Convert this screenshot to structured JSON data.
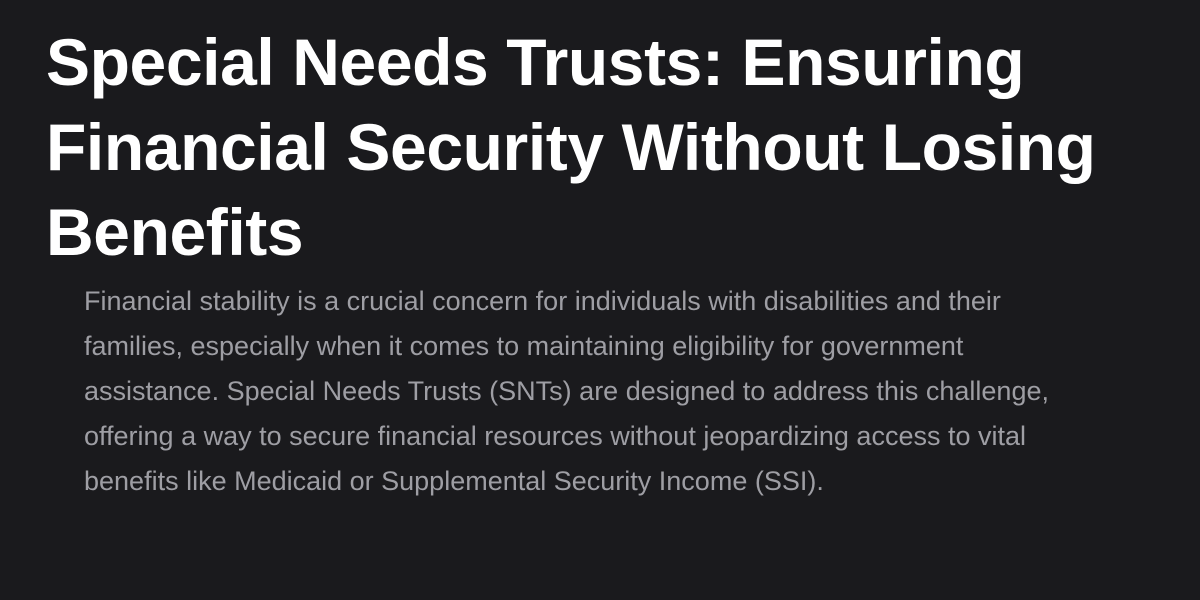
{
  "article": {
    "title": "Special Needs Trusts: Ensuring Financial Security Without Losing Benefits",
    "intro": "Financial stability is a crucial concern for individuals with disabilities and their families, especially when it comes to maintaining eligibility for government assistance. Special Needs Trusts (SNTs) are designed to address this challenge, offering a way to secure financial resources without jeopardizing access to vital benefits like Medicaid or Supplemental Security Income (SSI)."
  },
  "colors": {
    "background": "#1a1a1d",
    "title": "#ffffff",
    "body_text": "#9e9ea4"
  }
}
